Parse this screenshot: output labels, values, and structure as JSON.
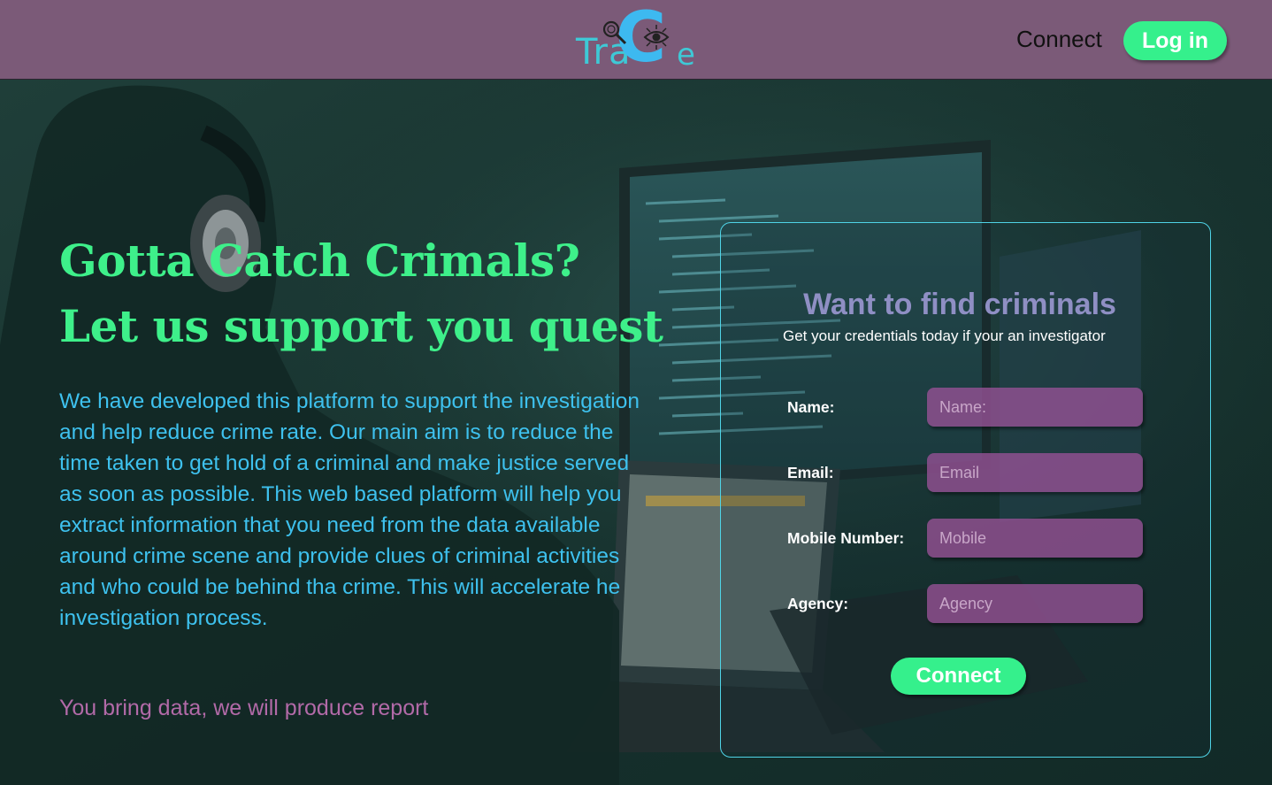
{
  "header": {
    "logo": {
      "part1": "Tra",
      "big_letter": "C",
      "part2": "e"
    },
    "nav_connect_label": "Connect",
    "login_label": "Log in"
  },
  "hero": {
    "headline_line1": "Gotta Catch Crimals?",
    "headline_line2": "Let us support you quest",
    "description": "We have developed this platform to support the investigation and help reduce crime rate. Our main aim is to reduce the time taken to get hold of a criminal and make justice served as soon as possible. This web based platform will help you extract information that you need from the data available around crime scene and provide clues of criminal activities and who could be behind tha crime. This will accelerate he investigation process.",
    "tagline": "You bring data, we will produce report"
  },
  "form": {
    "title": "Want to find criminals",
    "subtitle": "Get your credentials today if your an investigator",
    "fields": [
      {
        "label": "Name:",
        "placeholder": "Name:",
        "value": ""
      },
      {
        "label": "Email:",
        "placeholder": "Email",
        "value": ""
      },
      {
        "label": "Mobile Number:",
        "placeholder": "Mobile",
        "value": ""
      },
      {
        "label": "Agency:",
        "placeholder": "Agency",
        "value": ""
      }
    ],
    "submit_label": "Connect"
  },
  "colors": {
    "header_bg": "#7b5a78",
    "accent_green": "#35f08c",
    "headline_green": "#3ef08a",
    "description_blue": "#3ec1ee",
    "tagline_purple": "#b26aa8",
    "card_border": "#4fd3e6",
    "input_bg": "#925092"
  }
}
